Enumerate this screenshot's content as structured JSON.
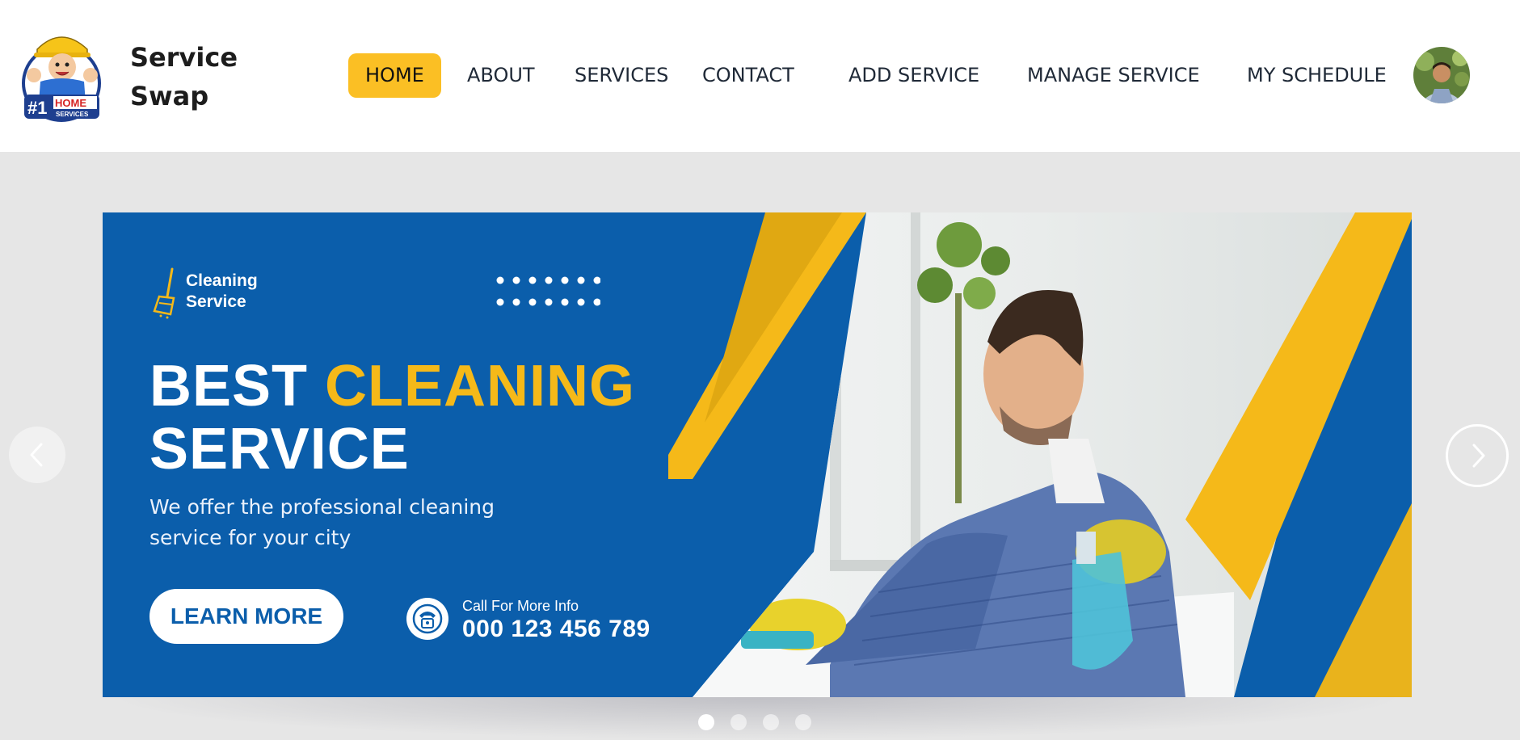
{
  "brand": {
    "name_line1": "Service",
    "name_line2": "Swap",
    "logo": {
      "icon": "home-services-mascot-logo",
      "text": "#1 HOME SERVICES"
    }
  },
  "nav": {
    "items": [
      {
        "label": "HOME",
        "active": true
      },
      {
        "label": "ABOUT",
        "active": false
      },
      {
        "label": "SERVICES",
        "active": false
      },
      {
        "label": "CONTACT",
        "active": false
      },
      {
        "label": "ADD SERVICE",
        "active": false
      },
      {
        "label": "MANAGE SERVICE",
        "active": false
      },
      {
        "label": "MY SCHEDULE",
        "active": false
      }
    ],
    "active_color": "#fbbf24"
  },
  "user": {
    "avatar_icon": "user-avatar"
  },
  "carousel": {
    "prev_icon": "chevron-left-icon",
    "next_icon": "chevron-right-icon",
    "slide_count": 4,
    "active_slide": 1,
    "slide": {
      "tag_line1": "Cleaning",
      "tag_line2": "Service",
      "title_word1": "BEST",
      "title_word2": "CLEANING",
      "title_word3": "SERVICE",
      "subtitle": "We offer the professional cleaning service for your city",
      "cta_label": "LEARN MORE",
      "call_label": "Call For More Info",
      "call_number": "000 123 456 789",
      "colors": {
        "primary": "#0b5eab",
        "accent": "#f5b919"
      }
    }
  }
}
